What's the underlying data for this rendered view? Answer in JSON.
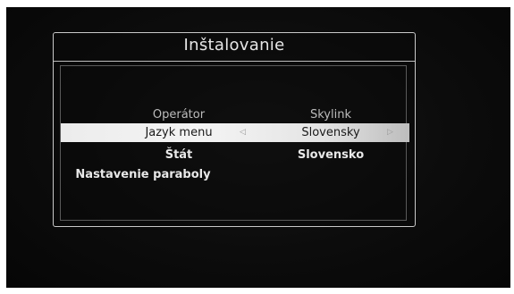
{
  "dialog": {
    "title": "Inštalovanie"
  },
  "menu": {
    "rows": [
      {
        "label": "Operátor",
        "value": "Skylink"
      },
      {
        "label": "Jazyk menu",
        "value": "Slovensky",
        "left_arrow": "◁",
        "right_arrow": "▷"
      },
      {
        "label": "Štát",
        "value": "Slovensko"
      },
      {
        "label": "Nastavenie paraboly",
        "value": ""
      }
    ]
  },
  "colors": {
    "selection_bar": "#ececec",
    "text": "#e8e8e8",
    "border": "#c9c9c9",
    "background": "#0c0c0c"
  }
}
